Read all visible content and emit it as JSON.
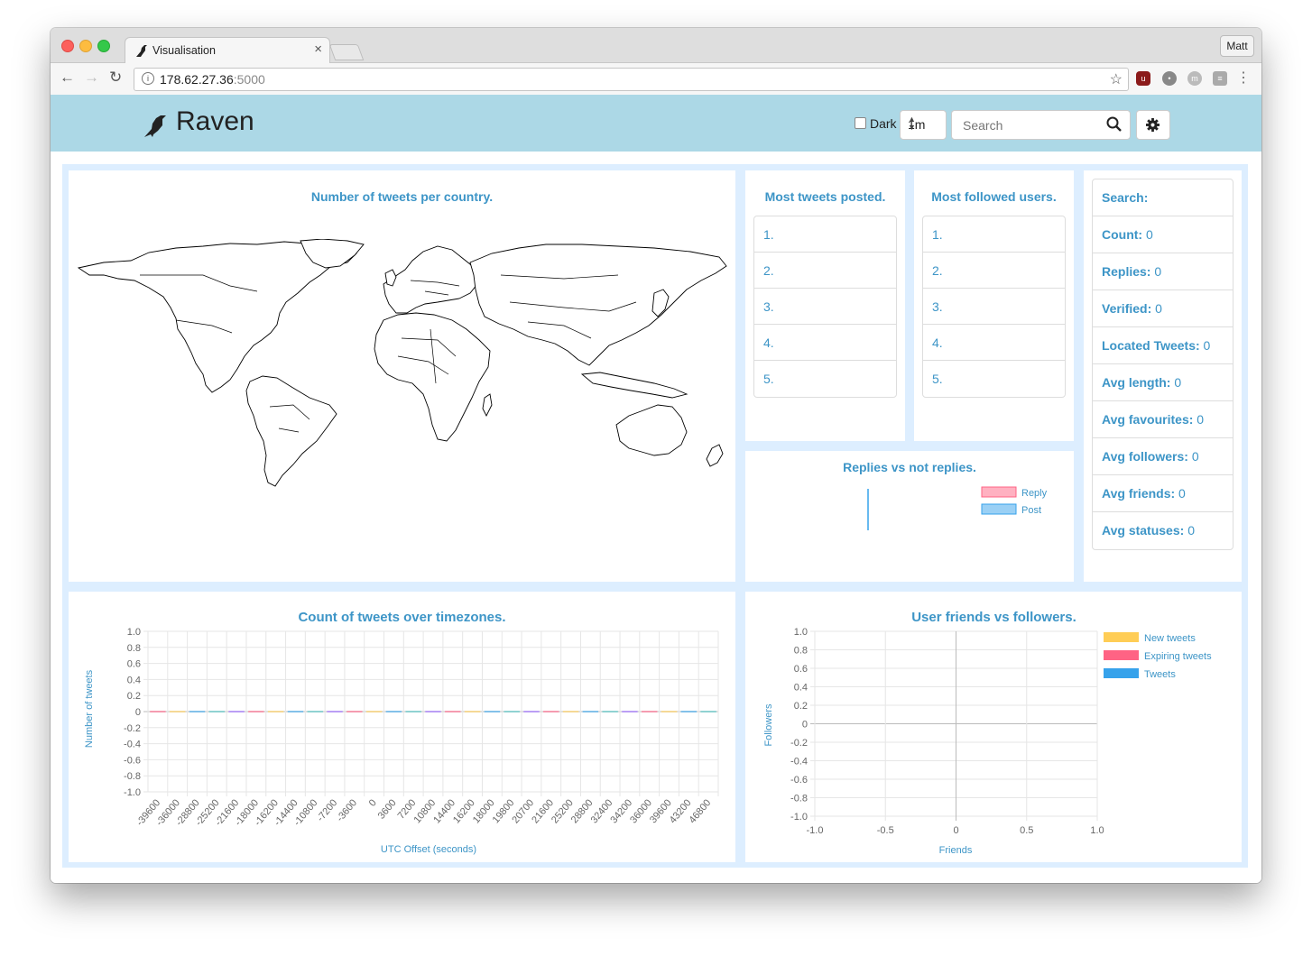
{
  "browser": {
    "tab_title": "Visualisation",
    "profile": "Matt",
    "url_host": "178.62.27.36",
    "url_port": ":5000"
  },
  "nav": {
    "brand": "Raven",
    "dark_label": "Dark",
    "interval_value": "1m",
    "search_placeholder": "Search"
  },
  "map_panel": {
    "title": "Number of tweets per country."
  },
  "most_tweets": {
    "title": "Most tweets posted.",
    "items": [
      "1.",
      "2.",
      "3.",
      "4.",
      "5."
    ]
  },
  "most_followed": {
    "title": "Most followed users.",
    "items": [
      "1.",
      "2.",
      "3.",
      "4.",
      "5."
    ]
  },
  "stats": {
    "search_label": "Search:",
    "rows": [
      {
        "label": "Count:",
        "value": "0"
      },
      {
        "label": "Replies:",
        "value": "0"
      },
      {
        "label": "Verified:",
        "value": "0"
      },
      {
        "label": "Located Tweets:",
        "value": "0"
      },
      {
        "label": "Avg length:",
        "value": "0"
      },
      {
        "label": "Avg favourites:",
        "value": "0"
      },
      {
        "label": "Avg followers:",
        "value": "0"
      },
      {
        "label": "Avg friends:",
        "value": "0"
      },
      {
        "label": "Avg statuses:",
        "value": "0"
      }
    ]
  },
  "colors": {
    "accent": "#3d95c7",
    "navbar": "#acd8e6",
    "panel_bg": "#ddeeff",
    "reply": "#ffb1c1",
    "post": "#9ad0f5",
    "new_tweets": "#ffcd56",
    "expiring_tweets": "#ff6384",
    "tweets": "#36a2eb"
  },
  "chart_data": [
    {
      "type": "bar",
      "title": "Replies vs not replies.",
      "series": [
        {
          "name": "Reply",
          "values": [
            0
          ]
        },
        {
          "name": "Post",
          "values": [
            0
          ]
        }
      ]
    },
    {
      "type": "bar",
      "title": "Count of tweets over timezones.",
      "xlabel": "UTC Offset (seconds)",
      "ylabel": "Number of tweets",
      "ylim": [
        -1.0,
        1.0
      ],
      "yticks": [
        "1.0",
        "0.8",
        "0.6",
        "0.4",
        "0.2",
        "0",
        "-0.2",
        "-0.4",
        "-0.6",
        "-0.8",
        "-1.0"
      ],
      "categories": [
        "-39600",
        "-36000",
        "-28800",
        "-25200",
        "-21600",
        "-18000",
        "-16200",
        "-14400",
        "-10800",
        "-7200",
        "-3600",
        "0",
        "3600",
        "7200",
        "10800",
        "14400",
        "16200",
        "18000",
        "19800",
        "20700",
        "21600",
        "25200",
        "28800",
        "32400",
        "34200",
        "36000",
        "39600",
        "43200",
        "46800"
      ],
      "values": [
        0,
        0,
        0,
        0,
        0,
        0,
        0,
        0,
        0,
        0,
        0,
        0,
        0,
        0,
        0,
        0,
        0,
        0,
        0,
        0,
        0,
        0,
        0,
        0,
        0,
        0,
        0,
        0,
        0
      ],
      "grid": true
    },
    {
      "type": "scatter",
      "title": "User friends vs followers.",
      "xlabel": "Friends",
      "ylabel": "Followers",
      "xlim": [
        -1.0,
        1.0
      ],
      "ylim": [
        -1.0,
        1.0
      ],
      "xticks": [
        "-1.0",
        "-0.5",
        "0",
        "0.5",
        "1.0"
      ],
      "yticks": [
        "1.0",
        "0.8",
        "0.6",
        "0.4",
        "0.2",
        "0",
        "-0.2",
        "-0.4",
        "-0.6",
        "-0.8",
        "-1.0"
      ],
      "series": [
        {
          "name": "New tweets",
          "points": []
        },
        {
          "name": "Expiring tweets",
          "points": []
        },
        {
          "name": "Tweets",
          "points": []
        }
      ],
      "legend": "right",
      "grid": true
    }
  ]
}
